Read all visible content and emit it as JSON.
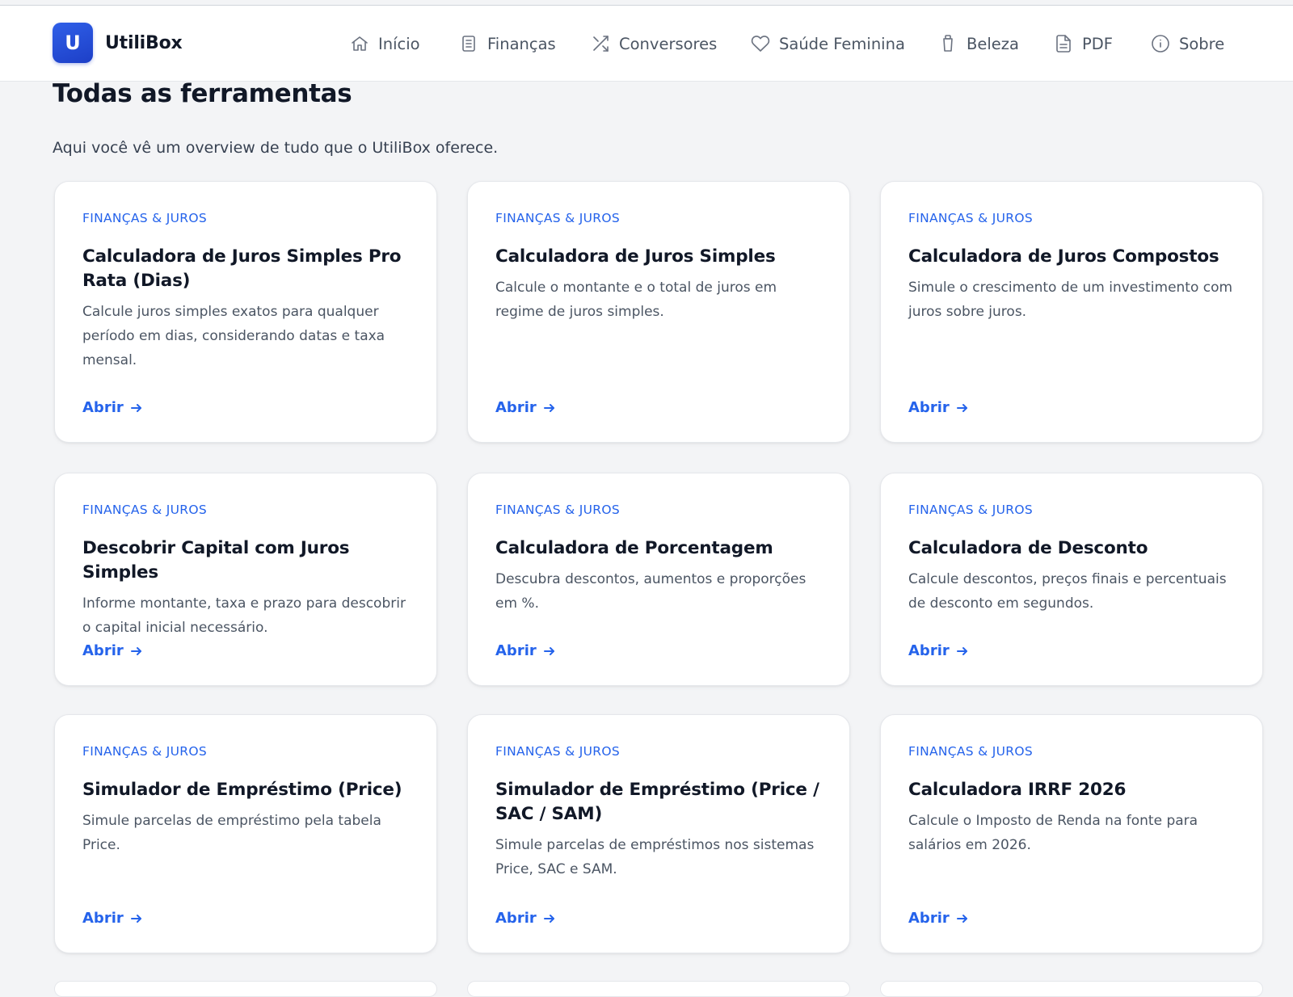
{
  "brand": {
    "logo_letter": "U",
    "name": "UtiliBox",
    "accent": "#2563eb"
  },
  "nav": [
    {
      "label": "Início",
      "icon": "home-icon"
    },
    {
      "label": "Finanças",
      "icon": "document-list-icon"
    },
    {
      "label": "Conversores",
      "icon": "shuffle-icon"
    },
    {
      "label": "Saúde Feminina",
      "icon": "heart-icon"
    },
    {
      "label": "Beleza",
      "icon": "cup-icon"
    },
    {
      "label": "PDF",
      "icon": "file-icon"
    },
    {
      "label": "Sobre",
      "icon": "info-icon"
    }
  ],
  "page": {
    "title": "Todas as ferramentas",
    "subtitle": "Aqui você vê um overview de tudo que o UtiliBox oferece."
  },
  "cards": [
    {
      "category": "Finanças & Juros",
      "title": "Calculadora de Juros Simples Pro Rata (Dias)",
      "description": "Calcule juros simples exatos para qualquer período em dias, considerando datas e taxa mensal.",
      "link": "Abrir"
    },
    {
      "category": "Finanças & Juros",
      "title": "Calculadora de Juros Simples",
      "description": "Calcule o montante e o total de juros em regime de juros simples.",
      "link": "Abrir"
    },
    {
      "category": "Finanças & Juros",
      "title": "Calculadora de Juros Compostos",
      "description": "Simule o crescimento de um investimento com juros sobre juros.",
      "link": "Abrir"
    },
    {
      "category": "Finanças & Juros",
      "title": "Descobrir Capital com Juros Simples",
      "description": "Informe montante, taxa e prazo para descobrir o capital inicial necessário.",
      "link": "Abrir"
    },
    {
      "category": "Finanças & Juros",
      "title": "Calculadora de Porcentagem",
      "description": "Descubra descontos, aumentos e proporções em %.",
      "link": "Abrir"
    },
    {
      "category": "Finanças & Juros",
      "title": "Calculadora de Desconto",
      "description": "Calcule descontos, preços finais e percentuais de desconto em segundos.",
      "link": "Abrir"
    },
    {
      "category": "Finanças & Juros",
      "title": "Simulador de Empréstimo (Price)",
      "description": "Simule parcelas de empréstimo pela tabela Price.",
      "link": "Abrir"
    },
    {
      "category": "Finanças & Juros",
      "title": "Simulador de Empréstimo (Price / SAC / SAM)",
      "description": "Simule parcelas de empréstimos nos sistemas Price, SAC e SAM.",
      "link": "Abrir"
    },
    {
      "category": "Finanças & Juros",
      "title": "Calculadora IRRF 2026",
      "description": "Calcule o Imposto de Renda na fonte para salários em 2026.",
      "link": "Abrir"
    }
  ]
}
